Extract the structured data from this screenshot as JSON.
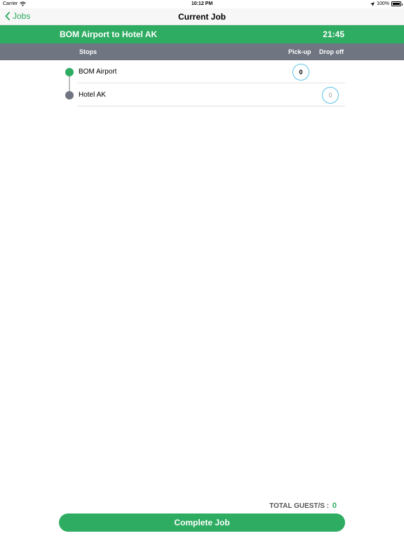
{
  "status_bar": {
    "carrier": "Carrier",
    "time": "10:12 PM",
    "battery": "100%",
    "icons": [
      "wifi-icon",
      "location-arrow-icon",
      "battery-icon"
    ]
  },
  "nav": {
    "back_label": "Jobs",
    "title": "Current Job"
  },
  "job": {
    "route": "BOM Airport to Hotel AK",
    "time": "21:45"
  },
  "columns": {
    "stops": "Stops",
    "pickup": "Pick-up",
    "dropoff": "Drop off"
  },
  "stops": [
    {
      "name": "BOM Airport",
      "pickup": "0",
      "dot_color": "#2eac62"
    },
    {
      "name": "Hotel AK",
      "dropoff": "0",
      "dot_color": "#6f7682"
    }
  ],
  "footer": {
    "total_label": "TOTAL GUEST/S :",
    "total_value": "0",
    "complete_label": "Complete Job"
  },
  "colors": {
    "accent_green": "#2eac62",
    "header_gray": "#6f7682",
    "counter_border": "#5bc3e4"
  }
}
